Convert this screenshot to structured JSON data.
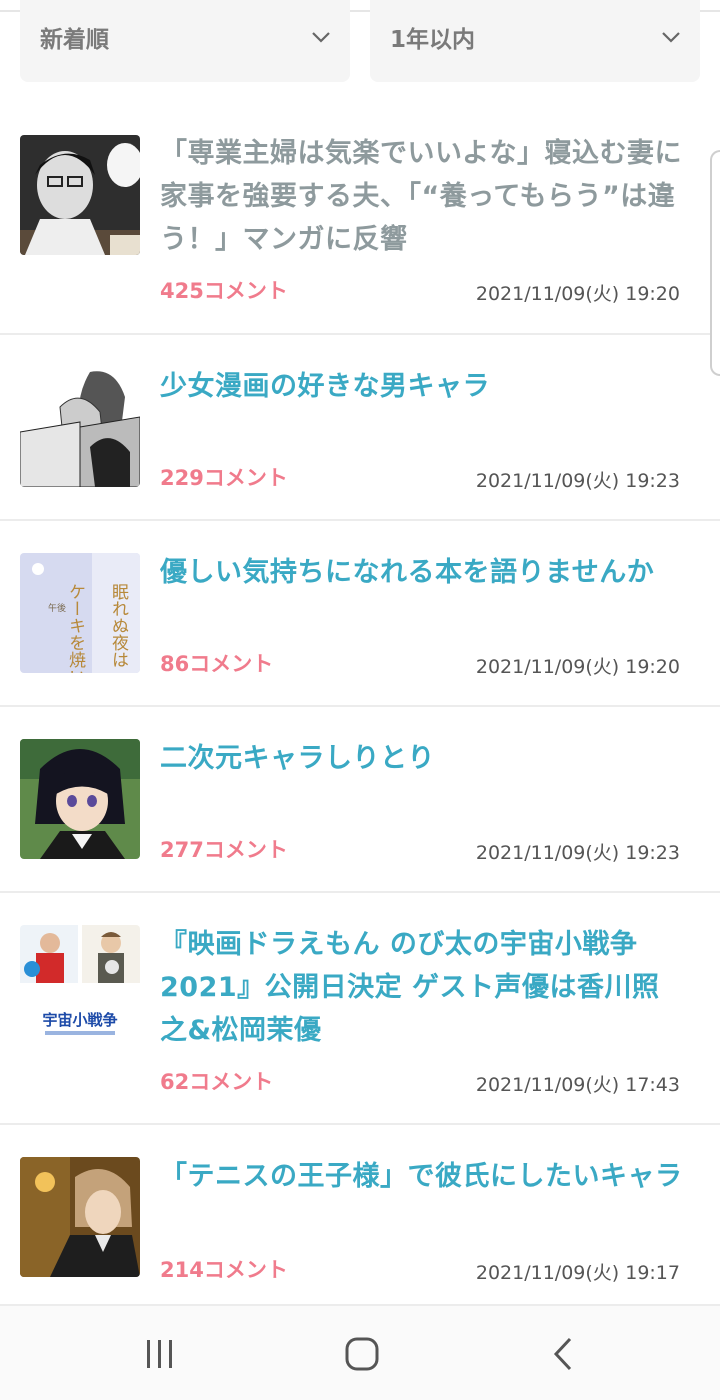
{
  "filters": {
    "sort": {
      "value": "新着順"
    },
    "period": {
      "value": "1年以内"
    }
  },
  "topics": [
    {
      "title": "「専業主婦は気楽でいいよな」寝込む妻に家事を強要する夫、「“養ってもらう”は違う！」マンガに反響",
      "comments": "425コメント",
      "date": "2021/11/09(火) 19:20",
      "visited": true
    },
    {
      "title": "少女漫画の好きな男キャラ",
      "comments": "229コメント",
      "date": "2021/11/09(火) 19:23",
      "visited": false
    },
    {
      "title": "優しい気持ちになれる本を語りませんか",
      "comments": "86コメント",
      "date": "2021/11/09(火) 19:20",
      "visited": false
    },
    {
      "title": "二次元キャラしりとり",
      "comments": "277コメント",
      "date": "2021/11/09(火) 19:23",
      "visited": false
    },
    {
      "title": "『映画ドラえもん のび太の宇宙小戦争2021』公開日決定 ゲスト声優は香川照之&松岡茉優",
      "comments": "62コメント",
      "date": "2021/11/09(火) 17:43",
      "visited": false
    },
    {
      "title": "「テニスの王子様」で彼氏にしたいキャラ",
      "comments": "214コメント",
      "date": "2021/11/09(火) 19:17",
      "visited": false
    }
  ],
  "thumbnails": {
    "book_cover_text": [
      "眠れぬ夜は",
      "ケーキを焼いて",
      "午後"
    ],
    "movie_logo_text": "宇宙小戦争"
  },
  "colors": {
    "title": "#3aa9c4",
    "title_visited": "#8e9a9d",
    "comments": "#f07b8c"
  },
  "navbar": {
    "icons": [
      "recent-apps-icon",
      "home-icon",
      "back-icon"
    ]
  }
}
